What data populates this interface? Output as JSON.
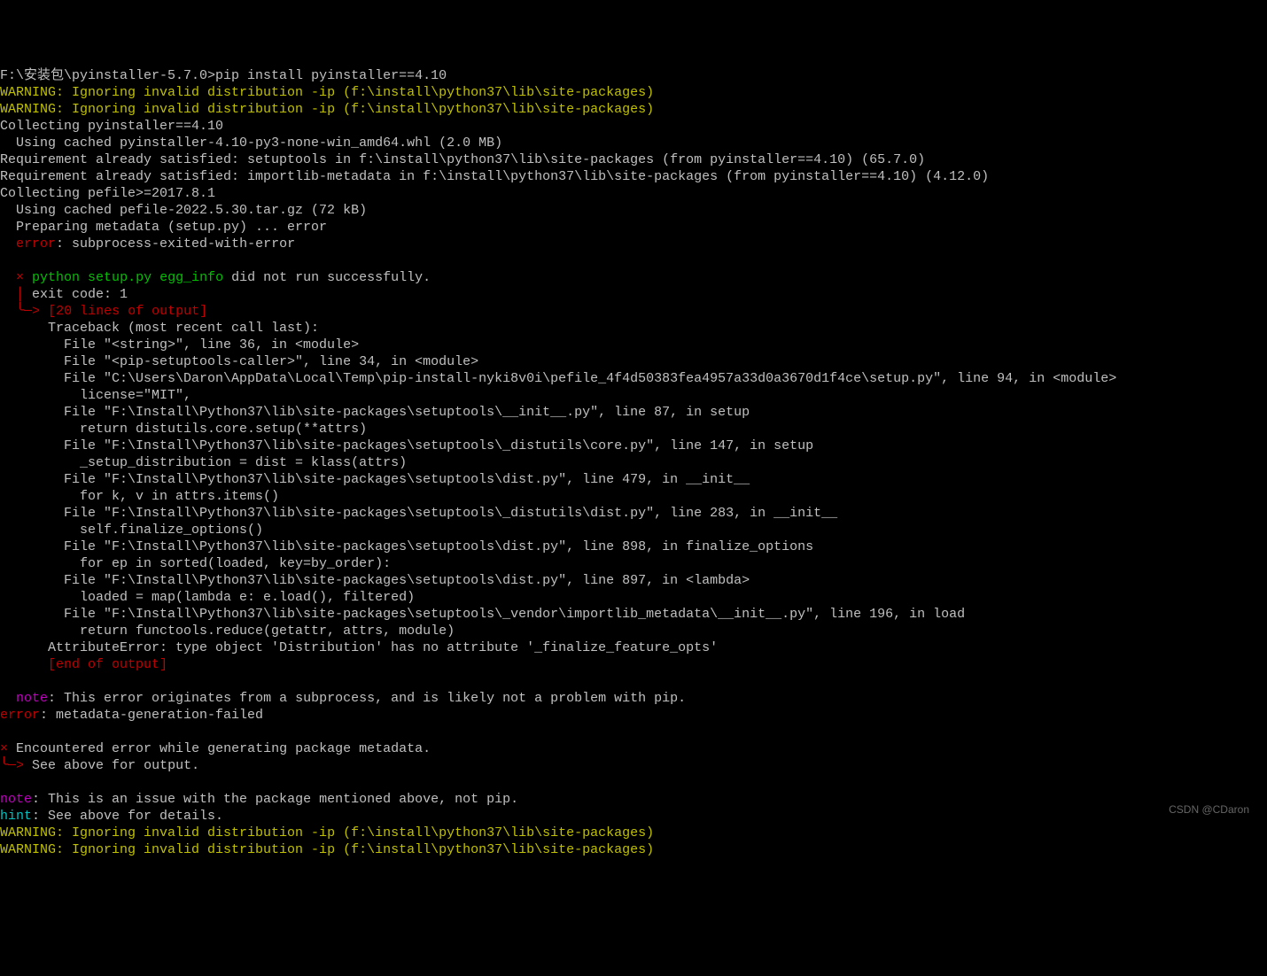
{
  "prompt": "F:\\安装包\\pyinstaller-5.7.0>",
  "command": "pip install pyinstaller==4.10",
  "warning1_prefix": "WARNING: ",
  "warning1_text": "Ignoring invalid distribution -ip (f:\\install\\python37\\lib\\site-packages)",
  "warning2_prefix": "WARNING: ",
  "warning2_text": "Ignoring invalid distribution -ip (f:\\install\\python37\\lib\\site-packages)",
  "collecting1": "Collecting pyinstaller==4.10",
  "using_cached1": "  Using cached pyinstaller-4.10-py3-none-win_amd64.whl (2.0 MB)",
  "req1": "Requirement already satisfied: setuptools in f:\\install\\python37\\lib\\site-packages (from pyinstaller==4.10) (65.7.0)",
  "req2": "Requirement already satisfied: importlib-metadata in f:\\install\\python37\\lib\\site-packages (from pyinstaller==4.10) (4.12.0)",
  "collecting2": "Collecting pefile>=2017.8.1",
  "using_cached2": "  Using cached pefile-2022.5.30.tar.gz (72 kB)",
  "preparing": "  Preparing metadata (setup.py) ... error",
  "error_label": "error",
  "error1_text": ": subprocess-exited-with-error",
  "x_mark": "×",
  "setup_py_text": "python setup.py egg_info",
  "setup_py_suffix": " did not run successfully.",
  "pipe": "│",
  "exit_code": " exit code: 1",
  "arrow": "╰─> ",
  "lines_output": "[20 lines of output]",
  "tb_header": "      Traceback (most recent call last):",
  "tb1": "        File \"<string>\", line 36, in <module>",
  "tb2": "        File \"<pip-setuptools-caller>\", line 34, in <module>",
  "tb3": "        File \"C:\\Users\\Daron\\AppData\\Local\\Temp\\pip-install-nyki8v0i\\pefile_4f4d50383fea4957a33d0a3670d1f4ce\\setup.py\", line 94, in <module>",
  "tb3b": "          license=\"MIT\",",
  "tb4": "        File \"F:\\Install\\Python37\\lib\\site-packages\\setuptools\\__init__.py\", line 87, in setup",
  "tb4b": "          return distutils.core.setup(**attrs)",
  "tb5": "        File \"F:\\Install\\Python37\\lib\\site-packages\\setuptools\\_distutils\\core.py\", line 147, in setup",
  "tb5b": "          _setup_distribution = dist = klass(attrs)",
  "tb6": "        File \"F:\\Install\\Python37\\lib\\site-packages\\setuptools\\dist.py\", line 479, in __init__",
  "tb6b": "          for k, v in attrs.items()",
  "tb7": "        File \"F:\\Install\\Python37\\lib\\site-packages\\setuptools\\_distutils\\dist.py\", line 283, in __init__",
  "tb7b": "          self.finalize_options()",
  "tb8": "        File \"F:\\Install\\Python37\\lib\\site-packages\\setuptools\\dist.py\", line 898, in finalize_options",
  "tb8b": "          for ep in sorted(loaded, key=by_order):",
  "tb9": "        File \"F:\\Install\\Python37\\lib\\site-packages\\setuptools\\dist.py\", line 897, in <lambda>",
  "tb9b": "          loaded = map(lambda e: e.load(), filtered)",
  "tb10": "        File \"F:\\Install\\Python37\\lib\\site-packages\\setuptools\\_vendor\\importlib_metadata\\__init__.py\", line 196, in load",
  "tb10b": "          return functools.reduce(getattr, attrs, module)",
  "attr_error": "      AttributeError: type object 'Distribution' has no attribute '_finalize_feature_opts'",
  "end_output": "[end of output]",
  "note_label": "note",
  "note1_text": ": This error originates from a subprocess, and is likely not a problem with pip.",
  "error2_text": ": metadata-generation-failed",
  "encountered": "Encountered error while generating package metadata.",
  "see_above": "See above for output.",
  "note2_text": ": This is an issue with the package mentioned above, not pip.",
  "hint_label": "hint",
  "hint_text": ": See above for details.",
  "warning3_prefix": "WARNING: ",
  "warning3_text": "Ignoring invalid distribution -ip (f:\\install\\python37\\lib\\site-packages)",
  "warning4_prefix": "WARNING: ",
  "warning4_text": "Ignoring invalid distribution -ip (f:\\install\\python37\\lib\\site-packages)",
  "watermark": "CSDN @CDaron"
}
